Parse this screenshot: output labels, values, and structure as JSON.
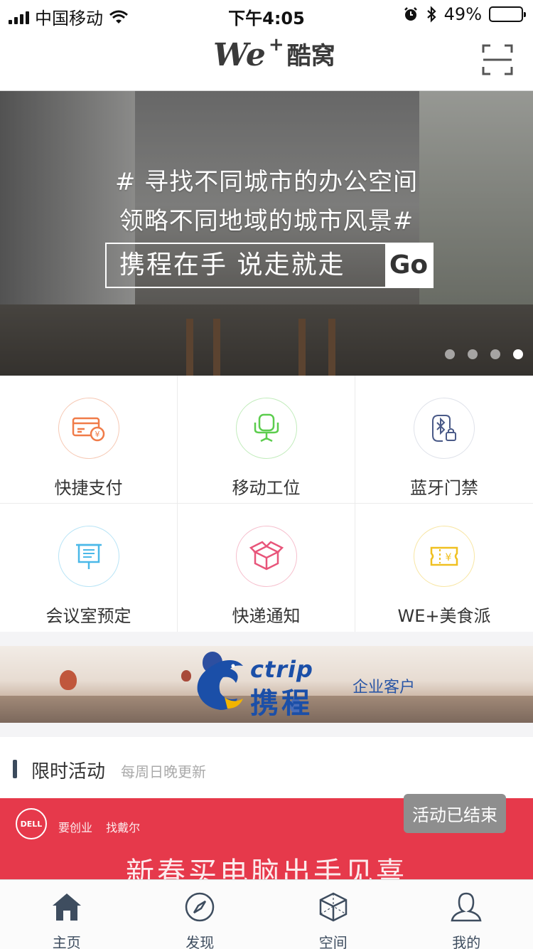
{
  "status_bar": {
    "carrier": "中国移动",
    "time": "下午4:05",
    "battery_percent": "49%",
    "battery_level": 0.49,
    "icons": [
      "signal-icon",
      "wifi-icon",
      "alarm-icon",
      "bluetooth-icon",
      "battery-icon"
    ]
  },
  "nav": {
    "logo_mark": "We",
    "logo_plus": "+",
    "logo_text": "酷窝",
    "scan_icon": "scan-icon"
  },
  "banner": {
    "line1": "# 寻找不同城市的办公空间",
    "line2": "领略不同地域的城市风景#",
    "cta_text": "携程在手 说走就走",
    "cta_go": "Go",
    "slide_count": 4,
    "active_slide": 4
  },
  "features": [
    {
      "label": "快捷支付",
      "icon": "payment-card-icon",
      "color": "#f07b48"
    },
    {
      "label": "移动工位",
      "icon": "office-chair-icon",
      "color": "#5ccd4e"
    },
    {
      "label": "蓝牙门禁",
      "icon": "bluetooth-lock-icon",
      "color": "#4a5a88"
    },
    {
      "label": "会议室预定",
      "icon": "presentation-board-icon",
      "color": "#4ab8e8"
    },
    {
      "label": "快递通知",
      "icon": "package-box-icon",
      "color": "#e8557a"
    },
    {
      "label": "WE+美食派",
      "icon": "food-ticket-icon",
      "color": "#f0c020"
    }
  ],
  "ctrip": {
    "word": "ctrip",
    "name": "携程",
    "subtitle": "企业客户"
  },
  "activities": {
    "title": "限时活动",
    "subtitle": "每周日晚更新",
    "card": {
      "brand": "DELL",
      "slogan_1": "要创业",
      "slogan_2": "找戴尔",
      "title": "新春买电脑出手见喜",
      "status": "活动已结束"
    }
  },
  "tabs": [
    {
      "label": "主页",
      "icon": "home-icon",
      "active": true
    },
    {
      "label": "发现",
      "icon": "compass-icon",
      "active": false
    },
    {
      "label": "空间",
      "icon": "cube-icon",
      "active": false
    },
    {
      "label": "我的",
      "icon": "user-icon",
      "active": false
    }
  ]
}
